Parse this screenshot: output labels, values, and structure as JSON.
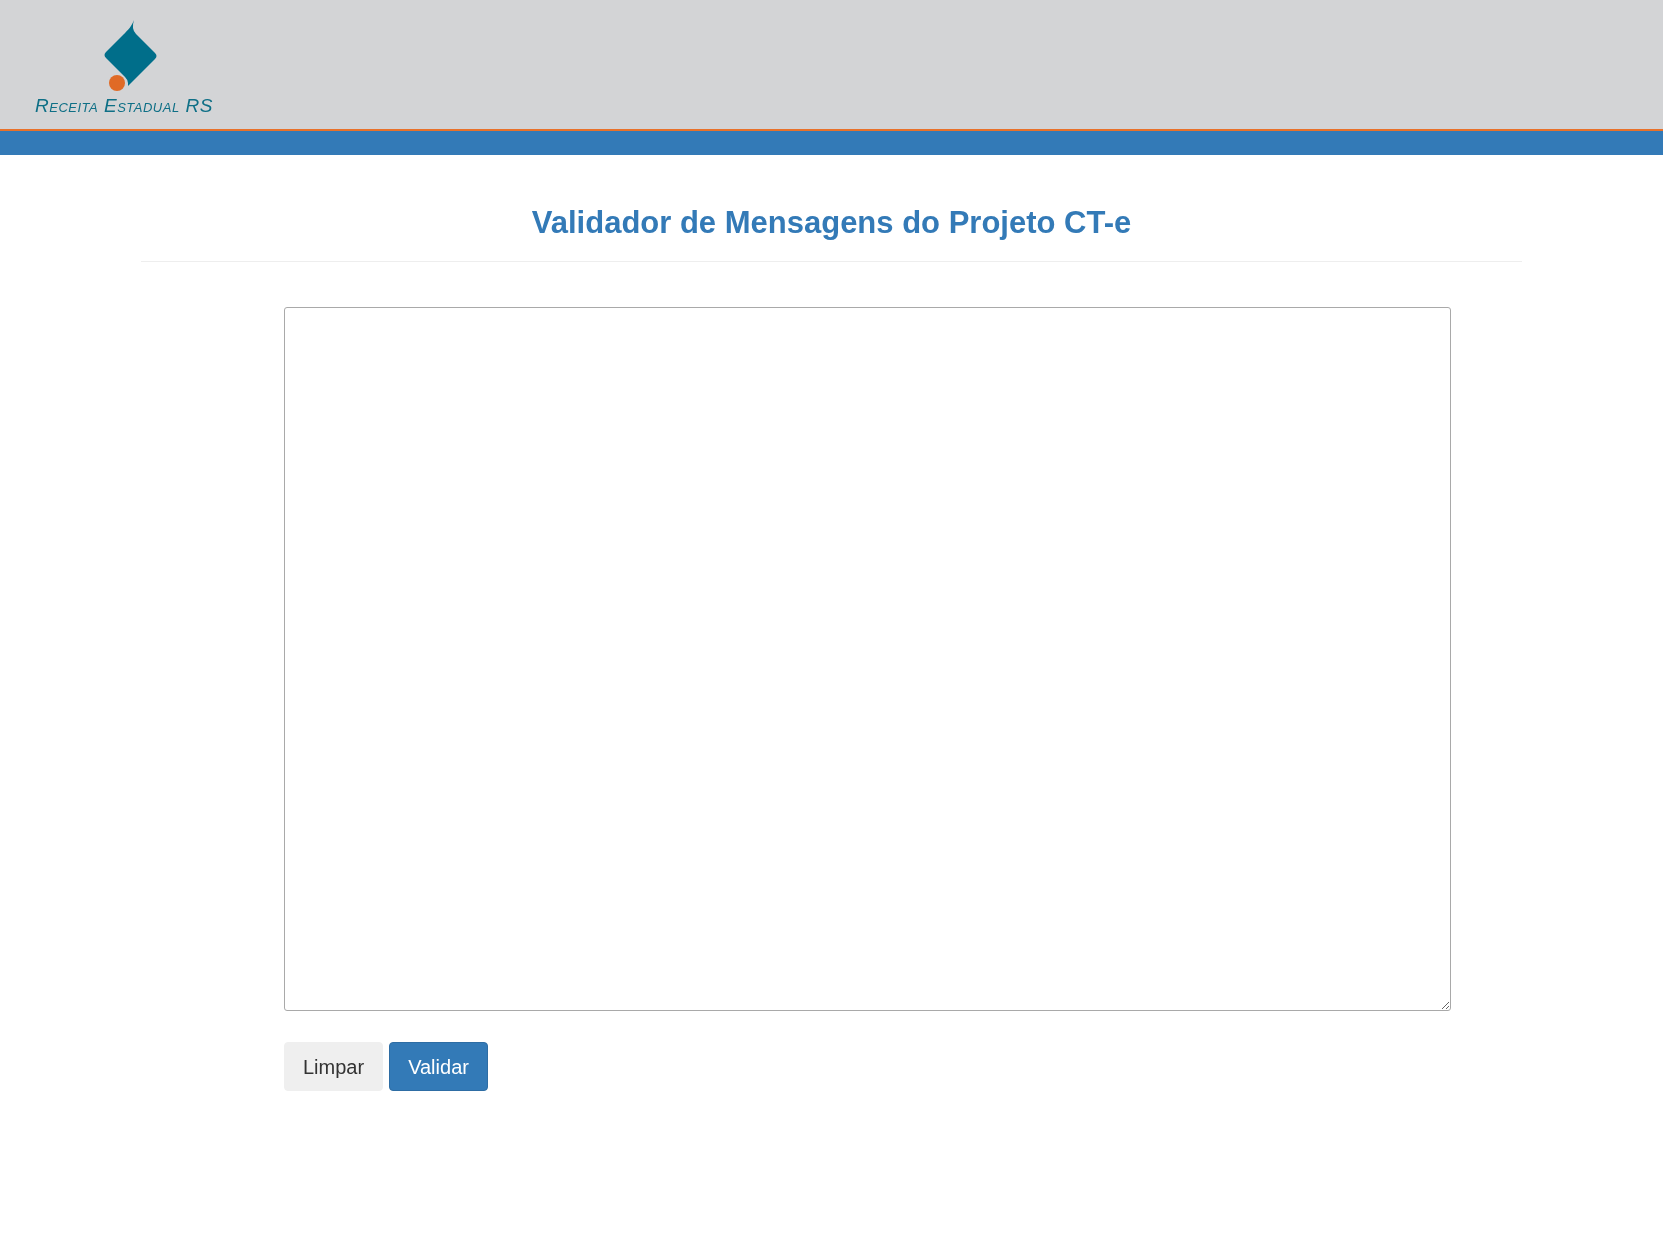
{
  "header": {
    "logo_text": "Receita Estadual RS"
  },
  "page": {
    "title": "Validador de Mensagens do Projeto CT-e"
  },
  "buttons": [
    {
      "label": "Limpar",
      "kind": "default"
    },
    {
      "label": "Validar",
      "kind": "primary"
    }
  ]
}
